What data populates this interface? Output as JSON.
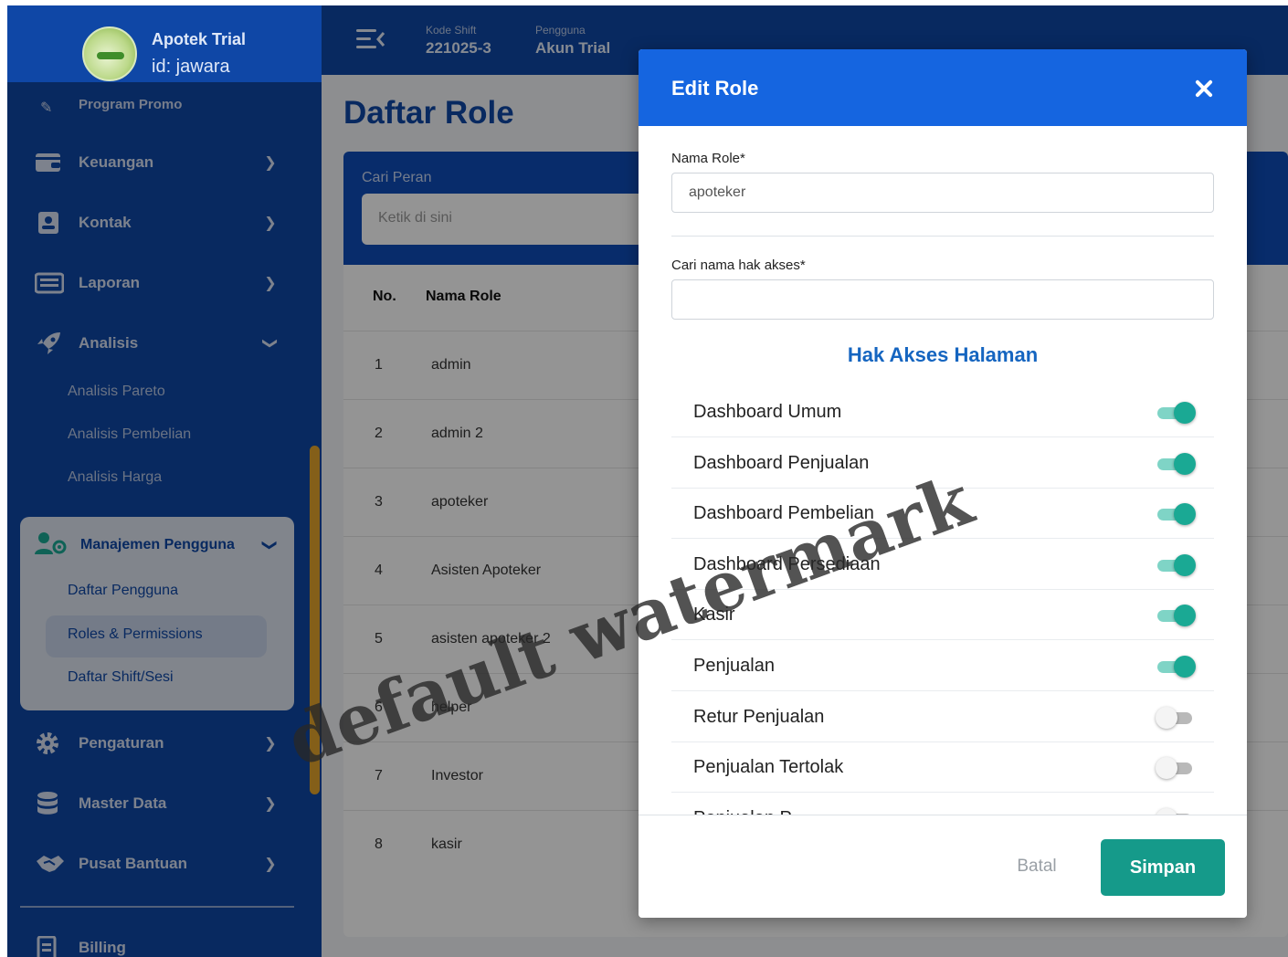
{
  "brand": {
    "name": "Apotek Trial",
    "id_label": "id: jawara"
  },
  "topbar": {
    "shift_label": "Kode Shift",
    "shift_value": "221025-3",
    "user_label": "Pengguna",
    "user_value": "Akun Trial"
  },
  "sidebar": {
    "cut_label": "Program Promo",
    "items": [
      {
        "label": "Keuangan",
        "icon": "wallet-icon"
      },
      {
        "label": "Kontak",
        "icon": "contact-icon"
      },
      {
        "label": "Laporan",
        "icon": "report-icon"
      },
      {
        "label": "Analisis",
        "icon": "rocket-icon"
      }
    ],
    "analisis_sub": [
      "Analisis Pareto",
      "Analisis Pembelian",
      "Analisis Harga"
    ],
    "group": {
      "label": "Manajemen Pengguna",
      "sub": [
        "Daftar Pengguna",
        "Roles & Permissions",
        "Daftar Shift/Sesi"
      ]
    },
    "items_after": [
      {
        "label": "Pengaturan",
        "icon": "gear-icon"
      },
      {
        "label": "Master Data",
        "icon": "database-icon"
      },
      {
        "label": "Pusat Bantuan",
        "icon": "handshake-icon"
      }
    ],
    "billing": "Billing"
  },
  "main": {
    "title": "Daftar Role",
    "search_label": "Cari Peran",
    "search_placeholder": "Ketik di sini",
    "headers": {
      "no": "No.",
      "name": "Nama Role"
    },
    "rows": [
      {
        "no": "1",
        "name": "admin"
      },
      {
        "no": "2",
        "name": "admin 2"
      },
      {
        "no": "3",
        "name": "apoteker"
      },
      {
        "no": "4",
        "name": "Asisten Apoteker"
      },
      {
        "no": "5",
        "name": "asisten apoteker 2"
      },
      {
        "no": "6",
        "name": "helper"
      },
      {
        "no": "7",
        "name": "Investor"
      },
      {
        "no": "8",
        "name": "kasir"
      }
    ]
  },
  "modal": {
    "title": "Edit Role",
    "role_label": "Nama Role*",
    "role_value": "apoteker",
    "search_label": "Cari nama hak akses*",
    "search_value": "",
    "section_title": "Hak Akses Halaman",
    "permissions": [
      {
        "label": "Dashboard Umum",
        "enabled": true
      },
      {
        "label": "Dashboard Penjualan",
        "enabled": true
      },
      {
        "label": "Dashboard Pembelian",
        "enabled": true
      },
      {
        "label": "Dashboard Persediaan",
        "enabled": true
      },
      {
        "label": "Kasir",
        "enabled": true
      },
      {
        "label": "Penjualan",
        "enabled": true
      },
      {
        "label": "Retur Penjualan",
        "enabled": false
      },
      {
        "label": "Penjualan Tertolak",
        "enabled": false
      },
      {
        "label": "Penjualan P...",
        "enabled": false
      }
    ],
    "cancel_label": "Batal",
    "save_label": "Simpan"
  },
  "colors": {
    "primary": "#0f47a6",
    "modal_header": "#1565e0",
    "accent": "#159a8a",
    "toggle_on": "#1aa994"
  },
  "watermark": "default watermark"
}
